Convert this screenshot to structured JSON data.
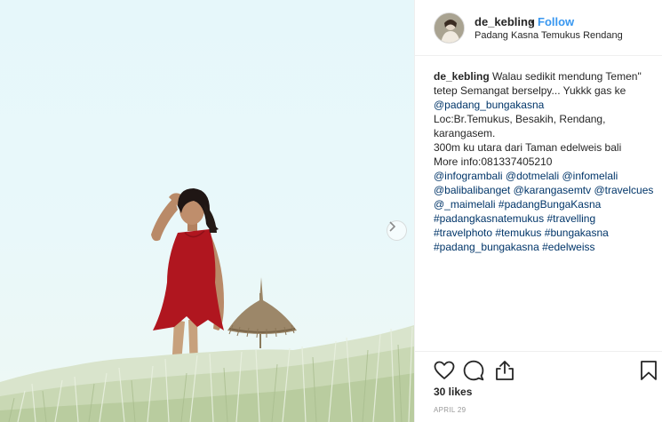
{
  "post": {
    "username": "de_kebling",
    "separator": "•",
    "follow_label": "Follow",
    "location": "Padang Kasna Temukus Rendang",
    "caption_lines": [
      [
        {
          "t": "de_kebling",
          "k": "user"
        },
        {
          "t": " Walau sedikit mendung Temen\"",
          "k": "text"
        }
      ],
      [
        {
          "t": "tetep Semangat berselpy... Yukkk gas ke",
          "k": "text"
        }
      ],
      [
        {
          "t": "@padang_bungakasna",
          "k": "tag"
        }
      ],
      [
        {
          "t": "Loc:Br.Temukus, Besakih, Rendang,",
          "k": "text"
        }
      ],
      [
        {
          "t": "karangasem.",
          "k": "text"
        }
      ],
      [
        {
          "t": "300m ku utara dari Taman edelweis bali",
          "k": "text"
        }
      ],
      [
        {
          "t": "More info:081337405210",
          "k": "text"
        }
      ],
      [
        {
          "t": "@infogrambali",
          "k": "tag"
        },
        {
          "t": " ",
          "k": "text"
        },
        {
          "t": "@dotmelali",
          "k": "tag"
        },
        {
          "t": " ",
          "k": "text"
        },
        {
          "t": "@infomelali",
          "k": "tag"
        }
      ],
      [
        {
          "t": "@balibalibanget",
          "k": "tag"
        },
        {
          "t": " ",
          "k": "text"
        },
        {
          "t": "@karangasemtv",
          "k": "tag"
        },
        {
          "t": " ",
          "k": "text"
        },
        {
          "t": "@travelcues",
          "k": "tag"
        }
      ],
      [
        {
          "t": "@_maimelali",
          "k": "tag"
        },
        {
          "t": " ",
          "k": "text"
        },
        {
          "t": "#padangBungaKasna",
          "k": "tag"
        }
      ],
      [
        {
          "t": "#padangkasnatemukus",
          "k": "tag"
        },
        {
          "t": " ",
          "k": "text"
        },
        {
          "t": "#travelling",
          "k": "tag"
        }
      ],
      [
        {
          "t": "#travelphoto",
          "k": "tag"
        },
        {
          "t": " ",
          "k": "text"
        },
        {
          "t": "#temukus",
          "k": "tag"
        },
        {
          "t": " ",
          "k": "text"
        },
        {
          "t": "#bungakasna",
          "k": "tag"
        }
      ],
      [
        {
          "t": "#padang_bungakasna",
          "k": "tag"
        },
        {
          "t": " ",
          "k": "text"
        },
        {
          "t": "#edelweiss",
          "k": "tag"
        }
      ]
    ],
    "likes": "30 likes",
    "date": "APRIL 29"
  },
  "icons": {
    "like": "heart-outline-icon",
    "comment": "comment-bubble-icon",
    "share": "share-upload-icon",
    "save": "bookmark-icon",
    "next": "chevron-right-icon"
  },
  "colors": {
    "link": "#003569",
    "follow": "#3897f0",
    "dress": "#b0161f",
    "sky": "#e6f7fa"
  }
}
